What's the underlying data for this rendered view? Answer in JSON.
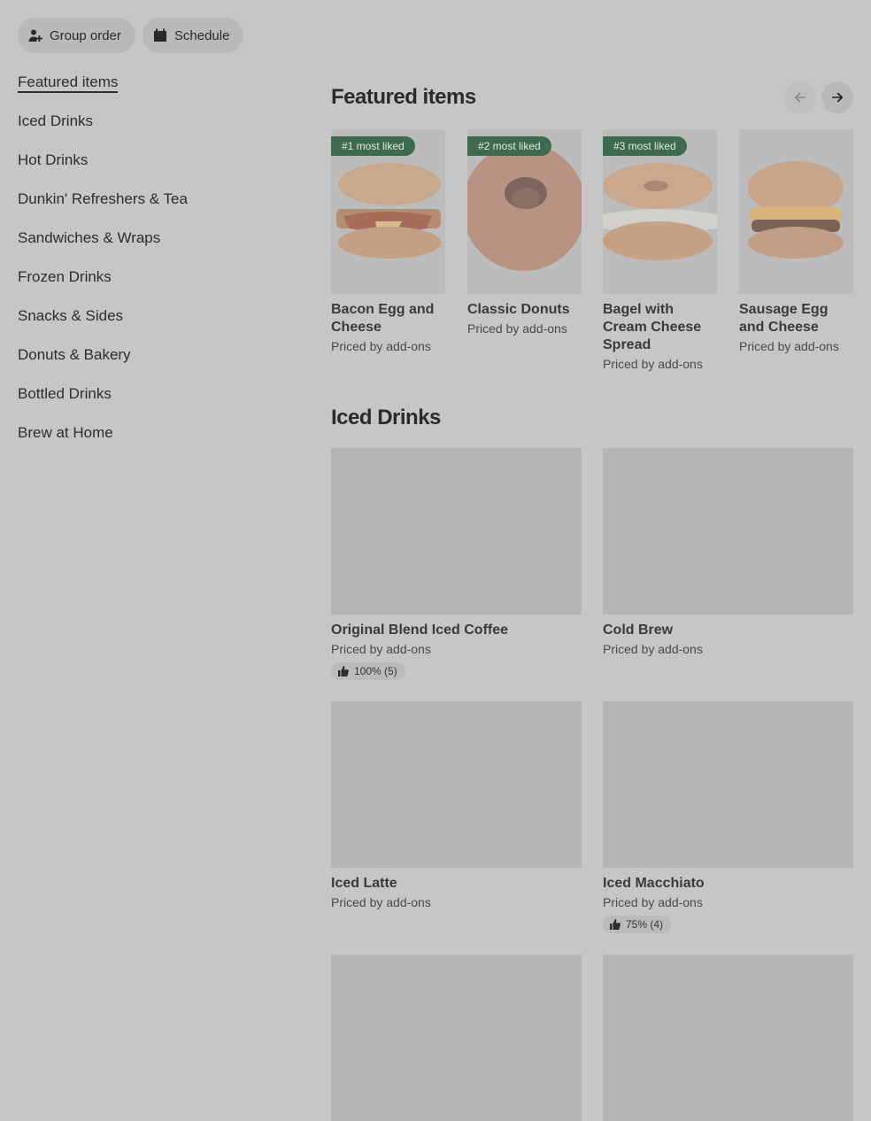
{
  "topbar": {
    "group_order": "Group order",
    "schedule": "Schedule"
  },
  "sidebar": {
    "items": [
      {
        "label": "Featured items"
      },
      {
        "label": "Iced Drinks"
      },
      {
        "label": "Hot Drinks"
      },
      {
        "label": "Dunkin' Refreshers & Tea"
      },
      {
        "label": "Sandwiches & Wraps"
      },
      {
        "label": "Frozen Drinks"
      },
      {
        "label": "Snacks & Sides"
      },
      {
        "label": "Donuts & Bakery"
      },
      {
        "label": "Bottled Drinks"
      },
      {
        "label": "Brew at Home"
      }
    ]
  },
  "featured": {
    "title": "Featured items",
    "items": [
      {
        "badge": "#1 most liked",
        "name": "Bacon Egg and Cheese",
        "price": "Priced by add-ons"
      },
      {
        "badge": "#2 most liked",
        "name": "Classic Donuts",
        "price": "Priced by add-ons"
      },
      {
        "badge": "#3 most liked",
        "name": "Bagel with Cream Cheese Spread",
        "price": "Priced by add-ons"
      },
      {
        "badge": "",
        "name": "Sausage Egg and Cheese",
        "price": "Priced by add-ons"
      }
    ]
  },
  "iced": {
    "title": "Iced Drinks",
    "items": [
      {
        "name": "Original Blend Iced Coffee",
        "price": "Priced by add-ons",
        "rating": "100% (5)"
      },
      {
        "name": "Cold Brew",
        "price": "Priced by add-ons",
        "rating": ""
      },
      {
        "name": "Iced Latte",
        "price": "Priced by add-ons",
        "rating": ""
      },
      {
        "name": "Iced Macchiato",
        "price": "Priced by add-ons",
        "rating": "75% (4)"
      }
    ]
  }
}
